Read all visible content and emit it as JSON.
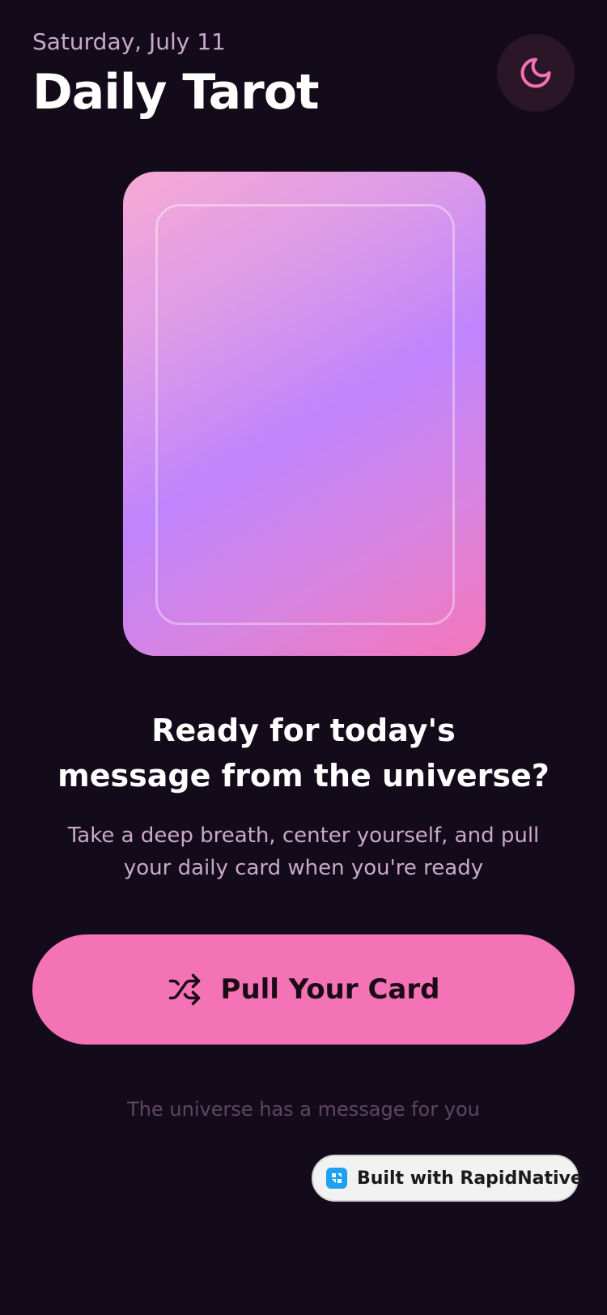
{
  "header": {
    "date": "Saturday, July 11",
    "title": "Daily Tarot",
    "theme_toggle_icon": "moon-icon"
  },
  "card": {
    "state": "face-down",
    "gradient_colors": [
      "#f7aad6",
      "#c084fc",
      "#f476b9"
    ]
  },
  "prompt": {
    "headline_line1": "Ready for today's",
    "headline_line2": "message from the universe?",
    "subtext_line1": "Take a deep breath, center yourself, and pull",
    "subtext_line2": "your daily card when you're ready"
  },
  "action": {
    "pull_label": "Pull Your Card",
    "pull_icon": "shuffle-icon"
  },
  "footer": {
    "note": "The universe has a message for you",
    "badge_label": "Built with RapidNative",
    "badge_icon": "rapidnative-logo-icon"
  },
  "colors": {
    "background": "#140b1a",
    "accent": "#f472b6",
    "muted_text": "#c9a8c9",
    "faint_text": "#5d4660"
  }
}
